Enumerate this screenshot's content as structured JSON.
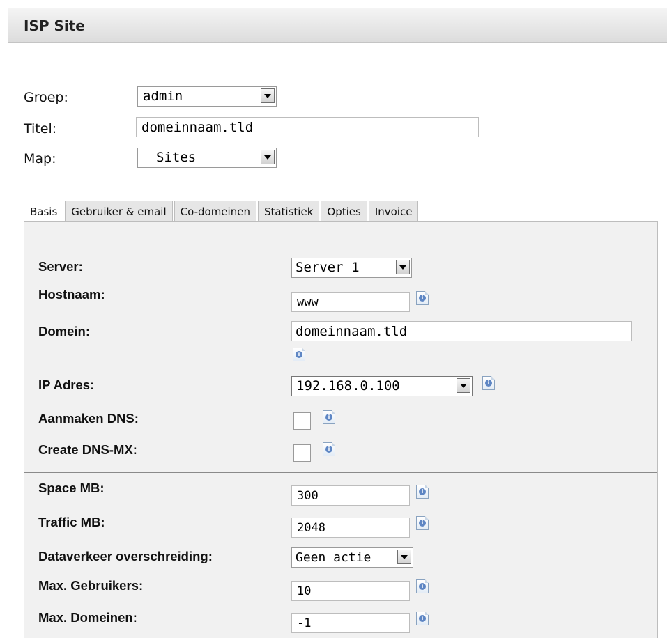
{
  "header": {
    "title": "ISP Site"
  },
  "record": {
    "groep": {
      "label": "Groep:",
      "value": "admin"
    },
    "titel": {
      "label": "Titel:",
      "value": "domeinnaam.tld"
    },
    "map": {
      "label": "Map:",
      "value": "Sites"
    }
  },
  "tabs": [
    {
      "label": "Basis",
      "active": true
    },
    {
      "label": "Gebruiker & email",
      "active": false
    },
    {
      "label": "Co-domeinen",
      "active": false
    },
    {
      "label": "Statistiek",
      "active": false
    },
    {
      "label": "Opties",
      "active": false
    },
    {
      "label": "Invoice",
      "active": false
    }
  ],
  "form": {
    "server": {
      "label": "Server:",
      "value": "Server 1"
    },
    "hostnaam": {
      "label": "Hostnaam:",
      "value": "www"
    },
    "domein": {
      "label": "Domein:",
      "value": "domeinnaam.tld"
    },
    "ip_adres": {
      "label": "IP Adres:",
      "value": "192.168.0.100"
    },
    "aanmaken_dns": {
      "label": "Aanmaken DNS:",
      "checked": false
    },
    "create_dns_mx": {
      "label": "Create DNS-MX:",
      "checked": false
    },
    "space_mb": {
      "label": "Space MB:",
      "value": "300"
    },
    "traffic_mb": {
      "label": "Traffic MB:",
      "value": "2048"
    },
    "dataverkeer": {
      "label": "Dataverkeer overschreiding:",
      "value": "Geen actie"
    },
    "max_gebruikers": {
      "label": "Max. Gebruikers:",
      "value": "10"
    },
    "max_domeinen": {
      "label": "Max. Domeinen:",
      "value": "-1"
    }
  },
  "icons": {
    "info": "info-icon",
    "dropdown": "chevron-down-icon"
  }
}
